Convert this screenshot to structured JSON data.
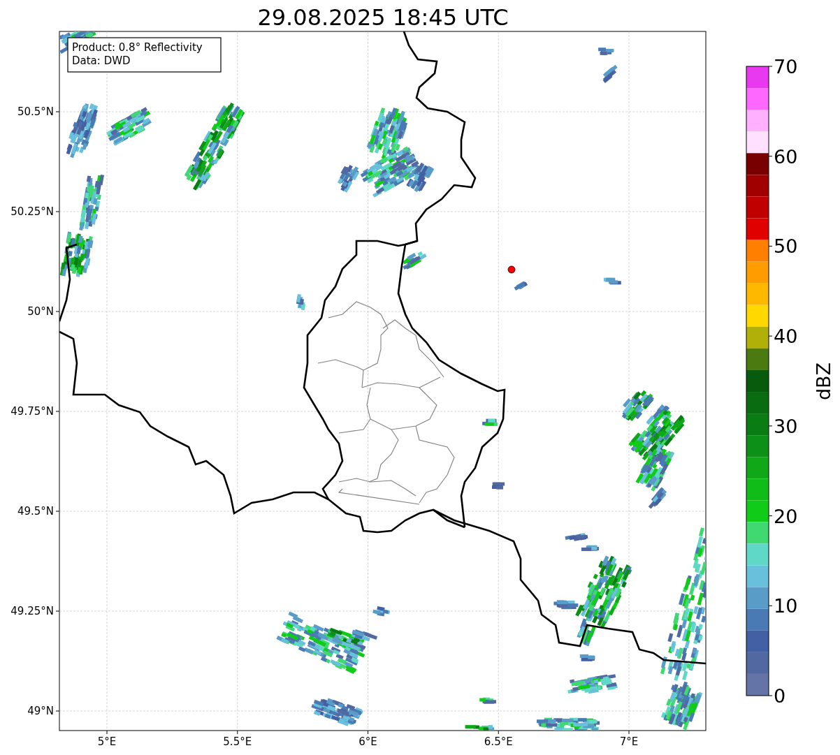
{
  "title": "29.08.2025 18:45 UTC",
  "map": {
    "info_lines": [
      "Product: 0.8° Reflectivity",
      "Data: DWD"
    ],
    "x_ticks": [
      "5°E",
      "5.5°E",
      "6°E",
      "6.5°E",
      "7°E"
    ],
    "y_ticks": [
      "50.5°N",
      "50.25°N",
      "50°N",
      "49.75°N",
      "49.5°N",
      "49.25°N",
      "49°N"
    ]
  },
  "colorbar": {
    "label": "dBZ",
    "ticks": [
      "70",
      "60",
      "50",
      "40",
      "30",
      "20",
      "10",
      "0"
    ],
    "bands": [
      {
        "color": "#e838f0"
      },
      {
        "color": "#ff68ff"
      },
      {
        "color": "#ffb0ff"
      },
      {
        "color": "#ffe0ff"
      },
      {
        "color": "#780000"
      },
      {
        "color": "#a00000"
      },
      {
        "color": "#c00000"
      },
      {
        "color": "#e00000"
      },
      {
        "color": "#ff8000"
      },
      {
        "color": "#ff9c00"
      },
      {
        "color": "#ffb800"
      },
      {
        "color": "#ffd800"
      },
      {
        "color": "#b0b008"
      },
      {
        "color": "#4a7a10"
      },
      {
        "color": "#085a0c"
      },
      {
        "color": "#0a6c10"
      },
      {
        "color": "#0a7c14"
      },
      {
        "color": "#0c9018"
      },
      {
        "color": "#10a818"
      },
      {
        "color": "#10bc18"
      },
      {
        "color": "#10cc18"
      },
      {
        "color": "#40d870"
      },
      {
        "color": "#60d8c8"
      },
      {
        "color": "#68c0dc"
      },
      {
        "color": "#5a9cc8"
      },
      {
        "color": "#4a7ab4"
      },
      {
        "color": "#4460a4"
      },
      {
        "color": "#5268a0"
      },
      {
        "color": "#6474a6"
      }
    ]
  }
}
